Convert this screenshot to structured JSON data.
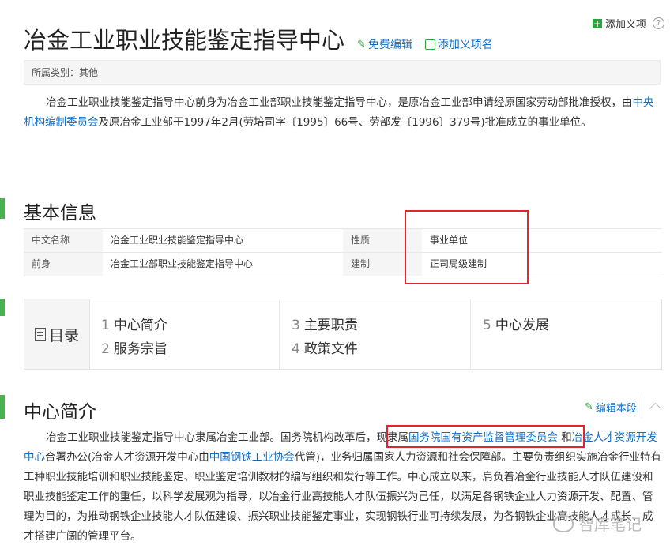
{
  "header": {
    "add_item": "添加义项",
    "help": "?",
    "title": "冶金工业职业技能鉴定指导中心",
    "edit": "免费编辑",
    "add_name": "添加义项名",
    "category": "所属类别：其他"
  },
  "intro": {
    "part1": "冶金工业职业技能鉴定指导中心前身为冶金工业部职业技能鉴定指导中心，是原冶金工业部申请经原国家劳动部批准授权，由",
    "link": "中央机构编制委员会",
    "part2": "及原冶金工业部于1997年2月(劳培司字〔1995〕66号、劳部发〔1996〕379号)批准成立的事业单位。"
  },
  "basic_info": {
    "title": "基本信息",
    "rows": [
      {
        "k1": "中文名称",
        "v1": "冶金工业职业技能鉴定指导中心",
        "k2": "性质",
        "v2": "事业单位"
      },
      {
        "k1": "前身",
        "v1": "冶金工业部职业技能鉴定指导中心",
        "k2": "建制",
        "v2": "正司局级建制"
      }
    ]
  },
  "toc": {
    "label": "目录",
    "items": [
      {
        "num": "1",
        "text": "中心简介"
      },
      {
        "num": "2",
        "text": "服务宗旨"
      },
      {
        "num": "3",
        "text": "主要职责"
      },
      {
        "num": "4",
        "text": "政策文件"
      },
      {
        "num": "5",
        "text": "中心发展"
      }
    ]
  },
  "section1": {
    "title": "中心简介",
    "edit": "编辑本段",
    "p_a": "冶金工业职业技能鉴定指导中心隶属冶金工业部。国务院机构改革后，",
    "p_b": "现隶属",
    "link1": "国务院国有资产监督管理委员会",
    "p_c": " 和",
    "link2": "冶金人才资源开发中心",
    "p_d": "合署办公(冶金人才资源开发中心由",
    "link3": "中国钢铁工业协会",
    "p_e": "代管)，业务归属国家人力资源和社会保障部。主要负责组织实施冶金行业特有工种职业技能培训和职业技能鉴定、职业鉴定培训教材的编写组织和发行等工作。中心成立以来，肩负着冶金行业技能人才队伍建设和职业技能鉴定工作的重任，以科学发展观为指导，以冶金行业高技能人才队伍振兴为己任，以满足各钢铁企业人力资源开发、配置、管理为目的，为推动钢铁企业技能人才队伍建设、振兴职业技能鉴定事业，实现钢铁行业可持续发展，为各钢铁企业高技能人才成长、成才搭建广阔的管理平台。"
  },
  "watermark": "智库笔记",
  "colors": {
    "link": "#136ec2",
    "accent_green": "#4bb14f",
    "highlight_red": "#e0262b"
  }
}
